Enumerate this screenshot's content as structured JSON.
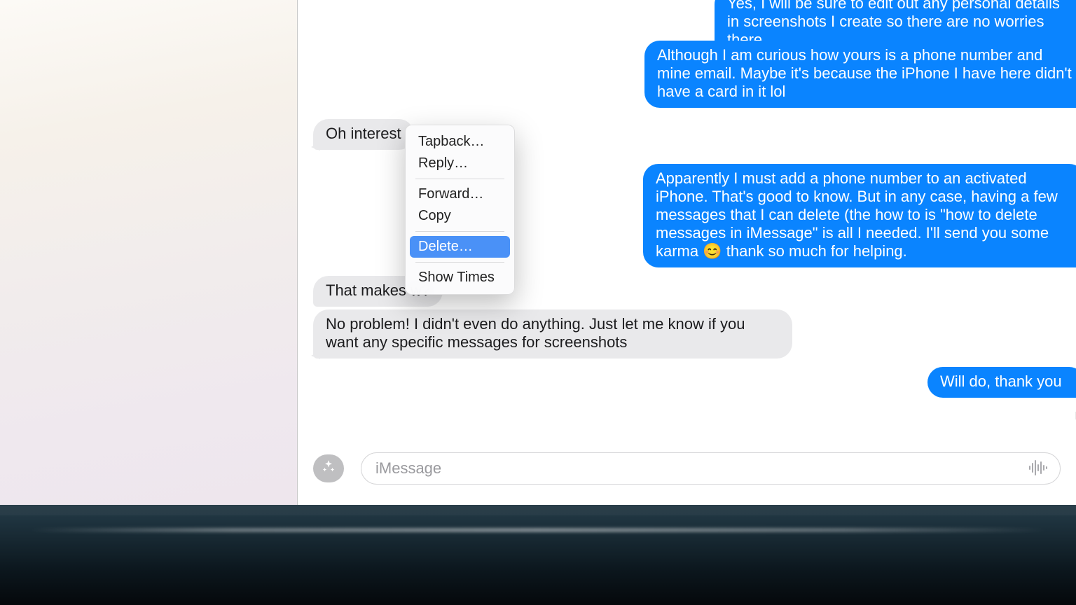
{
  "colors": {
    "sent_bubble": "#0a84ff",
    "recv_bubble": "#e9e9eb",
    "menu_highlight": "#4a91f7"
  },
  "messages": {
    "sent": [
      {
        "id": 0,
        "text": "Yes, I will be sure to edit out any personal details in screenshots I create so there are no worries there."
      },
      {
        "id": 1,
        "text": "Although I am curious how yours is a phone number and mine email. Maybe it's because the iPhone I have here didn't have a card in it lol"
      },
      {
        "id": 2,
        "text": "Apparently I must add a phone number to an activated iPhone. That's good to know. But in any case, having a few messages that I can delete (the how to is \"how to delete messages in iMessage\" is all I needed. I'll send you some karma 😊  thank so much for helping."
      },
      {
        "id": 3,
        "text": "Will do, thank you"
      }
    ],
    "received": [
      {
        "id": 0,
        "text": "Oh interest"
      },
      {
        "id": 1,
        "text": "That makes                         w?"
      },
      {
        "id": 2,
        "text": "No problem! I didn't even do anything. Just let me know if you want any specific messages for screenshots"
      }
    ],
    "status_last_sent": "D"
  },
  "context_menu": {
    "items": [
      {
        "label": "Tapback…",
        "selected": false
      },
      {
        "label": "Reply…",
        "selected": false
      },
      {
        "label": "Forward…",
        "selected": false
      },
      {
        "label": "Copy",
        "selected": false
      },
      {
        "label": "Delete…",
        "selected": true
      },
      {
        "label": "Show Times",
        "selected": false
      }
    ]
  },
  "compose": {
    "placeholder": "iMessage",
    "apps_button_name": "app-store-icon",
    "dictation_name": "dictation-icon"
  }
}
